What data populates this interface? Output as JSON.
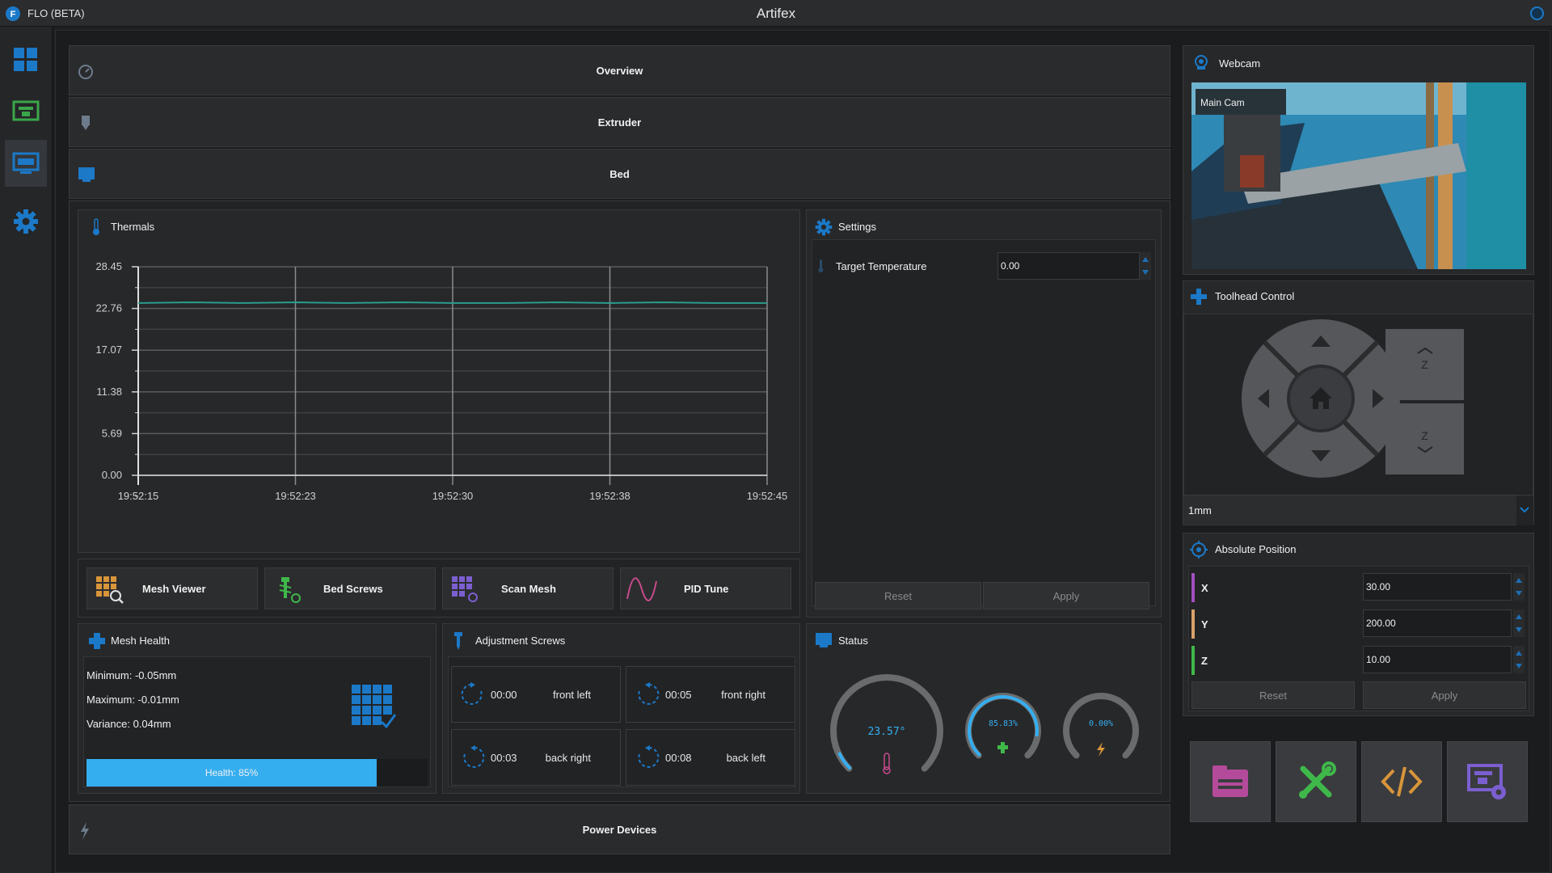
{
  "titlebar": {
    "app_name": "FLO (BETA)",
    "title": "Artifex"
  },
  "sidebar": {
    "items": [
      {
        "icon": "dashboard-icon"
      },
      {
        "icon": "printer-icon"
      },
      {
        "icon": "monitor-icon",
        "active": true
      },
      {
        "icon": "gear-icon"
      }
    ]
  },
  "sections": {
    "overview": "Overview",
    "extruder": "Extruder",
    "bed": "Bed",
    "power": "Power Devices"
  },
  "thermals": {
    "title": "Thermals",
    "chart_data": {
      "type": "line",
      "x": [
        "19:52:15",
        "19:52:23",
        "19:52:30",
        "19:52:38",
        "19:52:45"
      ],
      "ylim": [
        0,
        28.45
      ],
      "yticks": [
        "28.45",
        "22.76",
        "17.07",
        "11.38",
        "5.69",
        "0.00"
      ],
      "xticks": [
        "19:52:15",
        "19:52:23",
        "19:52:30",
        "19:52:38",
        "19:52:45"
      ],
      "series": [
        {
          "values": [
            23.5,
            23.6,
            23.5,
            23.6,
            23.5,
            23.6,
            23.5,
            23.5,
            23.6,
            23.5,
            23.6,
            23.5,
            23.5
          ],
          "color": "#2a9d8f"
        }
      ],
      "grid": true
    }
  },
  "bed_tools": [
    {
      "label": "Mesh Viewer",
      "icon": "mesh-viewer-icon"
    },
    {
      "label": "Bed Screws",
      "icon": "bed-screws-icon"
    },
    {
      "label": "Scan Mesh",
      "icon": "scan-mesh-icon"
    },
    {
      "label": "PID Tune",
      "icon": "pid-tune-icon"
    }
  ],
  "settings": {
    "title": "Settings",
    "target_label": "Target Temperature",
    "target_value": "0.00",
    "reset": "Reset",
    "apply": "Apply"
  },
  "mesh_health": {
    "title": "Mesh Health",
    "minimum": "Minimum: -0.05mm",
    "maximum": "Maximum: -0.01mm",
    "variance": "Variance: 0.04mm",
    "health_label": "Health: 85%",
    "health": 0.85
  },
  "screws": {
    "title": "Adjustment Screws",
    "items": [
      {
        "time": "00:00",
        "name": "front left"
      },
      {
        "time": "00:05",
        "name": "front right"
      },
      {
        "time": "00:03",
        "name": "back right"
      },
      {
        "time": "00:08",
        "name": "back left"
      }
    ]
  },
  "status": {
    "title": "Status",
    "temp": "23.57°",
    "temp_fraction": 0.07,
    "power": "85.83%",
    "power_fraction": 0.86,
    "fan": "0.00%",
    "fan_fraction": 0.0
  },
  "webcam": {
    "title": "Webcam",
    "cam_name": "Main Cam"
  },
  "toolhead": {
    "title": "Toolhead Control",
    "step": "1mm",
    "z_label": "Z"
  },
  "position": {
    "title": "Absolute Position",
    "x_label": "X",
    "x": "30.00",
    "y_label": "Y",
    "y": "200.00",
    "z_label": "Z",
    "z": "10.00",
    "reset": "Reset",
    "apply": "Apply"
  },
  "colors": {
    "accent": "#1b79c8",
    "x": "#a14fc0",
    "y": "#d8a26a",
    "z": "#3fb84a",
    "health": "#35aef0"
  },
  "shortcuts": [
    {
      "icon": "files-icon"
    },
    {
      "icon": "tools-icon"
    },
    {
      "icon": "console-icon"
    },
    {
      "icon": "printer-settings-icon"
    }
  ]
}
